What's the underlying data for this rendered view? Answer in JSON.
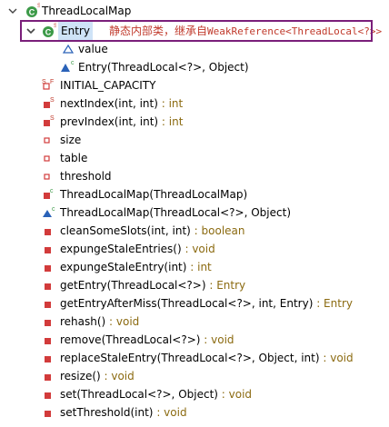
{
  "tree": {
    "root": {
      "label": "ThreadLocalMap"
    },
    "entry": {
      "label": "Entry",
      "annotation_zh": "静态内部类，继承自",
      "annotation_code": "WeakReference<ThreadLocal<?>>"
    },
    "entry_children": [
      {
        "name": "value",
        "ret": ""
      },
      {
        "name": "Entry(ThreadLocal<?>, Object)",
        "ret": ""
      }
    ],
    "members": [
      {
        "name": "INITIAL_CAPACITY",
        "ret": ""
      },
      {
        "name": "nextIndex(int, int)",
        "ret": " : int"
      },
      {
        "name": "prevIndex(int, int)",
        "ret": " : int"
      },
      {
        "name": "size",
        "ret": ""
      },
      {
        "name": "table",
        "ret": ""
      },
      {
        "name": "threshold",
        "ret": ""
      },
      {
        "name": "ThreadLocalMap(ThreadLocalMap)",
        "ret": ""
      },
      {
        "name": "ThreadLocalMap(ThreadLocal<?>, Object)",
        "ret": ""
      },
      {
        "name": "cleanSomeSlots(int, int)",
        "ret": " : boolean"
      },
      {
        "name": "expungeStaleEntries()",
        "ret": " : void"
      },
      {
        "name": "expungeStaleEntry(int)",
        "ret": " : int"
      },
      {
        "name": "getEntry(ThreadLocal<?>)",
        "ret": " : Entry"
      },
      {
        "name": "getEntryAfterMiss(ThreadLocal<?>, int, Entry)",
        "ret": " : Entry"
      },
      {
        "name": "rehash()",
        "ret": " : void"
      },
      {
        "name": "remove(ThreadLocal<?>)",
        "ret": " : void"
      },
      {
        "name": "replaceStaleEntry(ThreadLocal<?>, Object, int)",
        "ret": " : void"
      },
      {
        "name": "resize()",
        "ret": " : void"
      },
      {
        "name": "set(ThreadLocal<?>, Object)",
        "ret": " : void"
      },
      {
        "name": "setThreshold(int)",
        "ret": " : void"
      }
    ]
  },
  "colors": {
    "private_method": "#d23b3b",
    "public_method": "#2e8b3a",
    "constructor": "#2a62b8",
    "return_type": "#8b6a10",
    "annotation_text": "#c0392b",
    "highlight_border": "#7a1f7a",
    "selection_bg": "#cfe3f7"
  }
}
